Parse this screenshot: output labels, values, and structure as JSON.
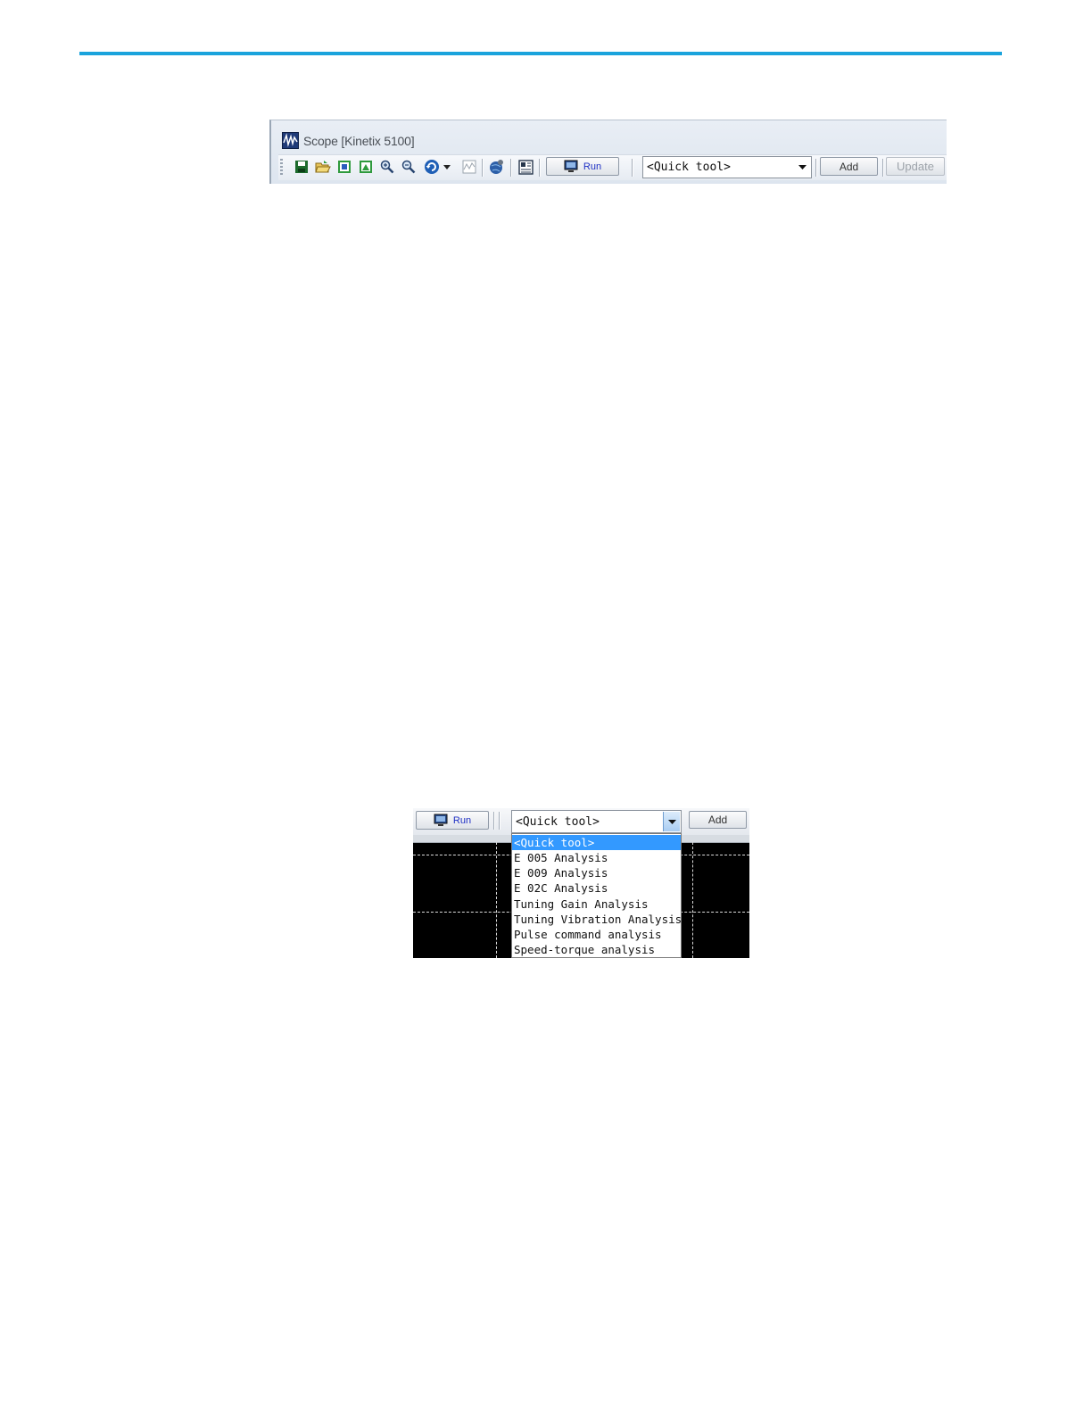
{
  "scope_window": {
    "title": "Scope [Kinetix 5100]",
    "toolbar": {
      "icons": [
        "save-icon",
        "open-folder-icon",
        "fit-view-icon",
        "fit-all-icon",
        "zoom-in-icon",
        "zoom-out-icon",
        "undo-icon",
        "dropdown-arrow-icon",
        "waveform-icon",
        "settings-globe-icon",
        "display-icon"
      ],
      "run_label": "Run",
      "quick_tool_value": "<Quick tool>",
      "add_label": "Add",
      "update_label": "Update"
    }
  },
  "dropdown_view": {
    "run_label": "Run",
    "quick_tool_value": "<Quick tool>",
    "add_label": "Add",
    "options": [
      "<Quick tool>",
      "E 005 Analysis",
      "E 009 Analysis",
      "E 02C Analysis",
      "Tuning Gain Analysis",
      "Tuning Vibration Analysis",
      "Pulse command analysis",
      "Speed-torque analysis"
    ],
    "selected_index": 0
  },
  "colors": {
    "accent_rule": "#1aa3dc",
    "selection": "#3399ff",
    "run_text": "#1e2fc4"
  }
}
